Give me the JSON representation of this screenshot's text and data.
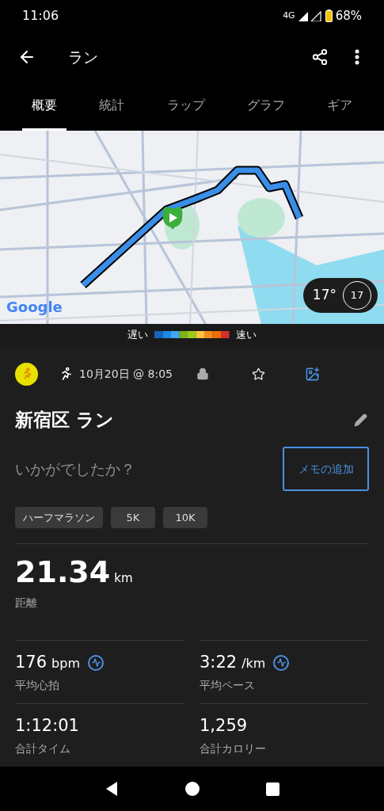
{
  "status_bar": {
    "time": "11:06",
    "network": "4G",
    "battery": "68%"
  },
  "app_bar": {
    "title": "ラン"
  },
  "tabs": [
    {
      "label": "概要",
      "selected": true
    },
    {
      "label": "統計",
      "selected": false
    },
    {
      "label": "ラップ",
      "selected": false
    },
    {
      "label": "グラフ",
      "selected": false
    },
    {
      "label": "ギア",
      "selected": false
    }
  ],
  "map": {
    "attribution": "Google",
    "weather": {
      "temperature": "17°",
      "badge": "17"
    },
    "legend": {
      "slow": "遅い",
      "fast": "速い"
    }
  },
  "activity": {
    "date": "10月20日 @ 8:05",
    "favorite": false,
    "title": "新宿区 ラン",
    "note_placeholder": "いかがでしたか？",
    "note_button": "メモの追加",
    "tags": [
      "ハーフマラソン",
      "5K",
      "10K"
    ],
    "distance": {
      "value": "21.34",
      "unit": "km",
      "label": "距離"
    },
    "stats": [
      {
        "kind": "chart",
        "value": "176",
        "unit": "bpm",
        "label": "平均心拍"
      },
      {
        "kind": "chart",
        "value": "3:22",
        "unit": "/km",
        "label": "平均ペース"
      },
      {
        "kind": "plain",
        "value": "1:12:01",
        "label": "合計タイム"
      },
      {
        "kind": "plain",
        "value": "1,259",
        "label": "合計カロリー"
      }
    ]
  }
}
